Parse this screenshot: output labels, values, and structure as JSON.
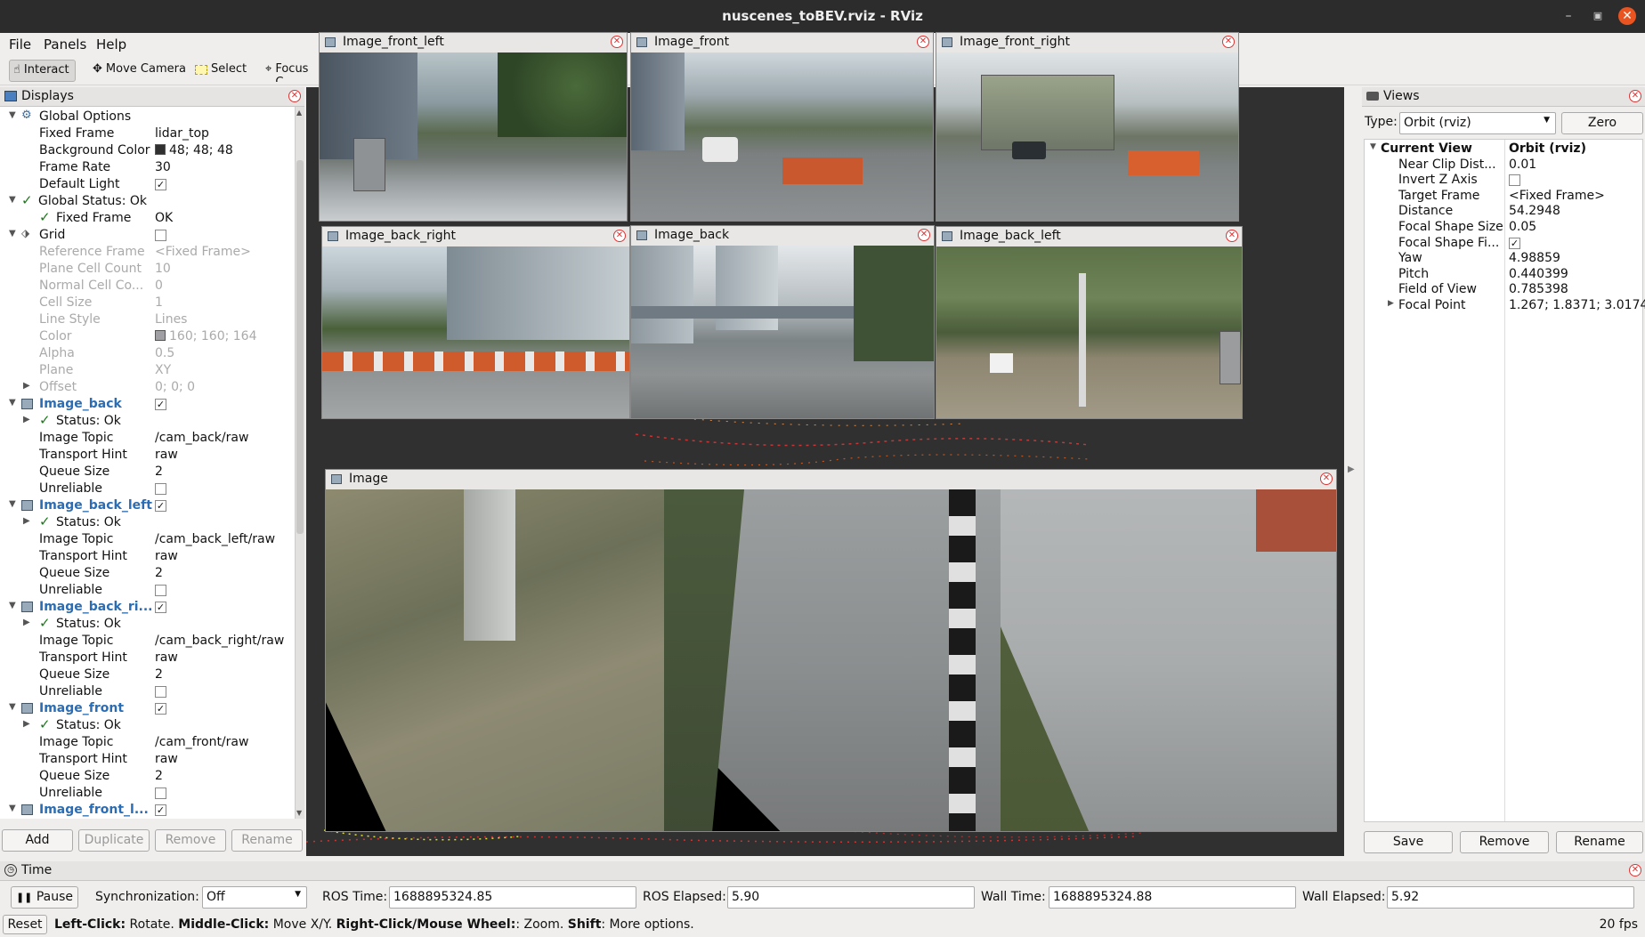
{
  "window": {
    "title": "nuscenes_toBEV.rviz - RViz"
  },
  "menu": [
    "File",
    "Panels",
    "Help"
  ],
  "toolbar": {
    "interact": "Interact",
    "move_camera": "Move Camera",
    "select": "Select",
    "focus": "Focus C"
  },
  "displays": {
    "title": "Displays",
    "rows": [
      {
        "k": "Global Options",
        "v": "",
        "lvl": 0,
        "arrow": "down",
        "icon": "gear-icon"
      },
      {
        "k": "Fixed Frame",
        "v": "lidar_top",
        "lvl": 1
      },
      {
        "k": "Background Color",
        "v": "48; 48; 48",
        "lvl": 1,
        "swatch": "#303030"
      },
      {
        "k": "Frame Rate",
        "v": "30",
        "lvl": 1
      },
      {
        "k": "Default Light",
        "v": "",
        "lvl": 1,
        "check": true
      },
      {
        "k": "Global Status: Ok",
        "v": "",
        "lvl": 0,
        "arrow": "down",
        "status": true
      },
      {
        "k": "Fixed Frame",
        "v": "OK",
        "lvl": 1,
        "status": true
      },
      {
        "k": "Grid",
        "v": "",
        "lvl": 0,
        "arrow": "down",
        "icon": "grid-icon",
        "check": false
      },
      {
        "k": "Reference Frame",
        "v": "<Fixed Frame>",
        "lvl": 1,
        "dim": true
      },
      {
        "k": "Plane Cell Count",
        "v": "10",
        "lvl": 1,
        "dim": true
      },
      {
        "k": "Normal Cell Co...",
        "v": "0",
        "lvl": 1,
        "dim": true
      },
      {
        "k": "Cell Size",
        "v": "1",
        "lvl": 1,
        "dim": true
      },
      {
        "k": "Line Style",
        "v": "Lines",
        "lvl": 1,
        "dim": true
      },
      {
        "k": "Color",
        "v": "160; 160; 164",
        "lvl": 1,
        "dim": true,
        "swatch": "#a0a0a4"
      },
      {
        "k": "Alpha",
        "v": "0.5",
        "lvl": 1,
        "dim": true
      },
      {
        "k": "Plane",
        "v": "XY",
        "lvl": 1,
        "dim": true
      },
      {
        "k": "Offset",
        "v": "0; 0; 0",
        "lvl": 1,
        "dim": true,
        "arrow": "right"
      },
      {
        "k": "Image_back",
        "v": "",
        "lvl": 0,
        "arrow": "down",
        "icon": "image-icon",
        "blue": true,
        "check": true
      },
      {
        "k": "Status: Ok",
        "v": "",
        "lvl": 1,
        "arrow": "right",
        "status": true
      },
      {
        "k": "Image Topic",
        "v": "/cam_back/raw",
        "lvl": 1
      },
      {
        "k": "Transport Hint",
        "v": "raw",
        "lvl": 1
      },
      {
        "k": "Queue Size",
        "v": "2",
        "lvl": 1
      },
      {
        "k": "Unreliable",
        "v": "",
        "lvl": 1,
        "check": false
      },
      {
        "k": "Image_back_left",
        "v": "",
        "lvl": 0,
        "arrow": "down",
        "icon": "image-icon",
        "blue": true,
        "check": true
      },
      {
        "k": "Status: Ok",
        "v": "",
        "lvl": 1,
        "arrow": "right",
        "status": true
      },
      {
        "k": "Image Topic",
        "v": "/cam_back_left/raw",
        "lvl": 1
      },
      {
        "k": "Transport Hint",
        "v": "raw",
        "lvl": 1
      },
      {
        "k": "Queue Size",
        "v": "2",
        "lvl": 1
      },
      {
        "k": "Unreliable",
        "v": "",
        "lvl": 1,
        "check": false
      },
      {
        "k": "Image_back_ri...",
        "v": "",
        "lvl": 0,
        "arrow": "down",
        "icon": "image-icon",
        "blue": true,
        "check": true
      },
      {
        "k": "Status: Ok",
        "v": "",
        "lvl": 1,
        "arrow": "right",
        "status": true
      },
      {
        "k": "Image Topic",
        "v": "/cam_back_right/raw",
        "lvl": 1
      },
      {
        "k": "Transport Hint",
        "v": "raw",
        "lvl": 1
      },
      {
        "k": "Queue Size",
        "v": "2",
        "lvl": 1
      },
      {
        "k": "Unreliable",
        "v": "",
        "lvl": 1,
        "check": false
      },
      {
        "k": "Image_front",
        "v": "",
        "lvl": 0,
        "arrow": "down",
        "icon": "image-icon",
        "blue": true,
        "check": true
      },
      {
        "k": "Status: Ok",
        "v": "",
        "lvl": 1,
        "arrow": "right",
        "status": true
      },
      {
        "k": "Image Topic",
        "v": "/cam_front/raw",
        "lvl": 1
      },
      {
        "k": "Transport Hint",
        "v": "raw",
        "lvl": 1
      },
      {
        "k": "Queue Size",
        "v": "2",
        "lvl": 1
      },
      {
        "k": "Unreliable",
        "v": "",
        "lvl": 1,
        "check": false
      },
      {
        "k": "Image_front_l...",
        "v": "",
        "lvl": 0,
        "arrow": "down",
        "icon": "image-icon",
        "blue": true,
        "check": true
      }
    ],
    "buttons": {
      "add": "Add",
      "duplicate": "Duplicate",
      "remove": "Remove",
      "rename": "Rename"
    }
  },
  "image_panels": [
    "Image_front_left",
    "Image_front",
    "Image_front_right",
    "Image_back_right",
    "Image_back",
    "Image_back_left",
    "Image"
  ],
  "views": {
    "title": "Views",
    "type_label": "Type:",
    "type_value": "Orbit (rviz)",
    "zero": "Zero",
    "rows": [
      {
        "k": "Current View",
        "v": "Orbit (rviz)",
        "bold": true,
        "arrow": "down"
      },
      {
        "k": "Near Clip Dist...",
        "v": "0.01"
      },
      {
        "k": "Invert Z Axis",
        "v": "",
        "check": false
      },
      {
        "k": "Target Frame",
        "v": "<Fixed Frame>"
      },
      {
        "k": "Distance",
        "v": "54.2948"
      },
      {
        "k": "Focal Shape Size",
        "v": "0.05"
      },
      {
        "k": "Focal Shape Fi...",
        "v": "",
        "check": true
      },
      {
        "k": "Yaw",
        "v": "4.98859"
      },
      {
        "k": "Pitch",
        "v": "0.440399"
      },
      {
        "k": "Field of View",
        "v": "0.785398"
      },
      {
        "k": "Focal Point",
        "v": "1.267; 1.8371; 3.0174",
        "arrow": "right"
      }
    ],
    "buttons": {
      "save": "Save",
      "remove": "Remove",
      "rename": "Rename"
    }
  },
  "time": {
    "title": "Time",
    "pause": "Pause",
    "sync_label": "Synchronization:",
    "sync_value": "Off",
    "ros_time_label": "ROS Time:",
    "ros_time": "1688895324.85",
    "ros_elapsed_label": "ROS Elapsed:",
    "ros_elapsed": "5.90",
    "wall_time_label": "Wall Time:",
    "wall_time": "1688895324.88",
    "wall_elapsed_label": "Wall Elapsed:",
    "wall_elapsed": "5.92"
  },
  "status": {
    "reset": "Reset",
    "b1": "Left-Click:",
    "t1": " Rotate. ",
    "b2": "Middle-Click:",
    "t2": " Move X/Y. ",
    "b3": "Right-Click/Mouse Wheel:",
    "t3": ": Zoom. ",
    "b4": "Shift",
    "t4": ": More options.",
    "fps": "20 fps"
  }
}
